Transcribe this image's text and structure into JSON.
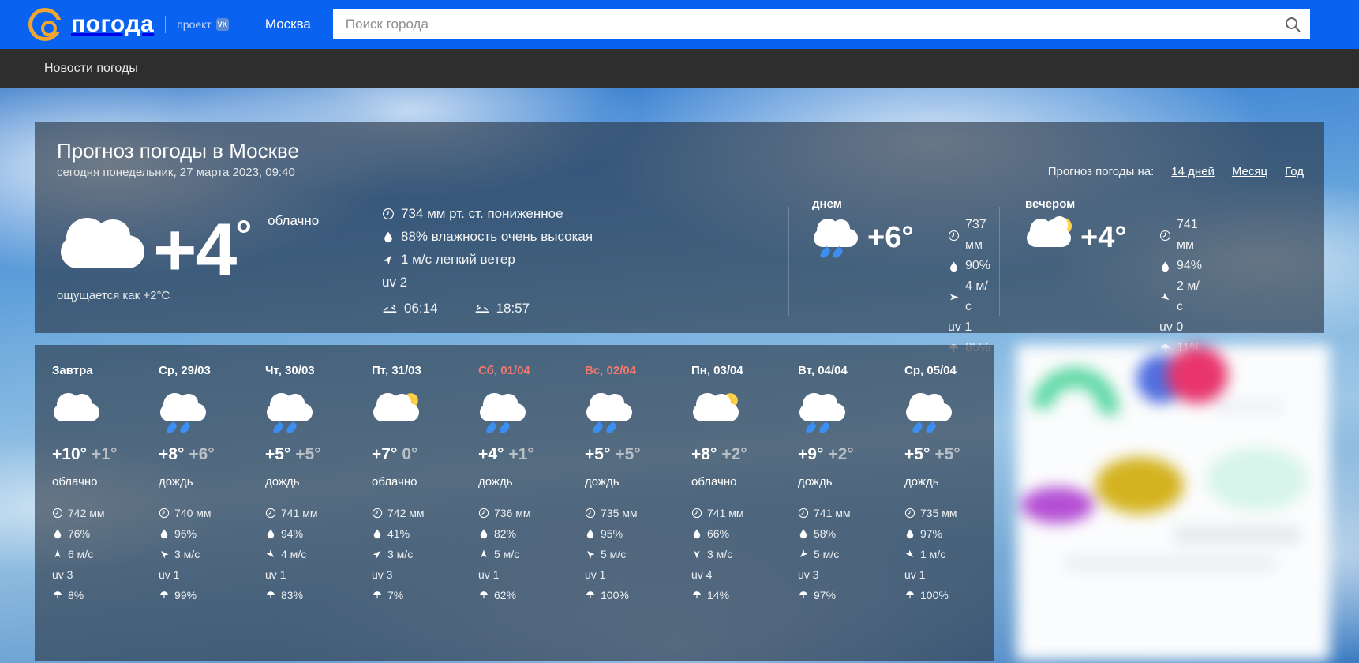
{
  "header": {
    "logo_text": "погода",
    "project_label": "проект",
    "vk_badge": "VK",
    "city_link": "Москва",
    "search_placeholder": "Поиск города",
    "search_value": ""
  },
  "nav": {
    "items": [
      {
        "label": "Новости погоды"
      }
    ]
  },
  "main": {
    "title": "Прогноз погоды в Москве",
    "subtitle": "сегодня понедельник, 27 марта 2023, 09:40",
    "forecast_links_label": "Прогноз погоды на:",
    "forecast_links": [
      {
        "label": "14 дней"
      },
      {
        "label": "Месяц"
      },
      {
        "label": "Год"
      }
    ],
    "current": {
      "icon": "cloud-icon",
      "temp": "+4",
      "degree": "°",
      "description": "облачно",
      "feels_like": "ощущается как +2°C",
      "pressure": "734 мм рт. ст. пониженное",
      "humidity": "88% влажность очень высокая",
      "wind": "1 м/с легкий ветер",
      "uv": "uv 2",
      "sunrise": "06:14",
      "sunset": "18:57"
    },
    "parts": [
      {
        "label": "днем",
        "icon": "cloud-rain-icon",
        "temp": "+6°",
        "pressure": "737 мм",
        "humidity": "90%",
        "wind": "4 м/с",
        "uv": "uv 1",
        "precip": "85%"
      },
      {
        "label": "вечером",
        "icon": "cloud-moon-icon",
        "temp": "+4°",
        "pressure": "741 мм",
        "humidity": "94%",
        "wind": "2 м/с",
        "uv": "uv 0",
        "precip": "11%"
      }
    ]
  },
  "days": [
    {
      "name": "Завтра",
      "weekend": false,
      "icon": "cloud-icon",
      "day_temp": "+10°",
      "night_temp": "+1°",
      "description": "облачно",
      "pressure": "742 мм",
      "humidity": "76%",
      "wind": "6 м/с",
      "wind_dir": "N",
      "uv": "uv 3",
      "precip": "8%"
    },
    {
      "name": "Ср, 29/03",
      "weekend": false,
      "icon": "cloud-rain-icon",
      "day_temp": "+8°",
      "night_temp": "+6°",
      "description": "дождь",
      "pressure": "740 мм",
      "humidity": "96%",
      "wind": "3 м/с",
      "wind_dir": "NW",
      "uv": "uv 1",
      "precip": "99%"
    },
    {
      "name": "Чт, 30/03",
      "weekend": false,
      "icon": "cloud-rain-icon",
      "day_temp": "+5°",
      "night_temp": "+5°",
      "description": "дождь",
      "pressure": "741 мм",
      "humidity": "94%",
      "wind": "4 м/с",
      "wind_dir": "SE",
      "uv": "uv 1",
      "precip": "83%"
    },
    {
      "name": "Пт, 31/03",
      "weekend": false,
      "icon": "cloud-sun-icon",
      "day_temp": "+7°",
      "night_temp": "0°",
      "description": "облачно",
      "pressure": "742 мм",
      "humidity": "41%",
      "wind": "3 м/с",
      "wind_dir": "NE",
      "uv": "uv 3",
      "precip": "7%"
    },
    {
      "name": "Сб, 01/04",
      "weekend": true,
      "icon": "cloud-rain-icon",
      "day_temp": "+4°",
      "night_temp": "+1°",
      "description": "дождь",
      "pressure": "736 мм",
      "humidity": "82%",
      "wind": "5 м/с",
      "wind_dir": "N",
      "uv": "uv 1",
      "precip": "62%"
    },
    {
      "name": "Вс, 02/04",
      "weekend": true,
      "icon": "cloud-rain-icon",
      "day_temp": "+5°",
      "night_temp": "+5°",
      "description": "дождь",
      "pressure": "735 мм",
      "humidity": "95%",
      "wind": "5 м/с",
      "wind_dir": "NW",
      "uv": "uv 1",
      "precip": "100%"
    },
    {
      "name": "Пн, 03/04",
      "weekend": false,
      "icon": "cloud-sun-icon",
      "day_temp": "+8°",
      "night_temp": "+2°",
      "description": "облачно",
      "pressure": "741 мм",
      "humidity": "66%",
      "wind": "3 м/с",
      "wind_dir": "S",
      "uv": "uv 4",
      "precip": "14%"
    },
    {
      "name": "Вт, 04/04",
      "weekend": false,
      "icon": "cloud-rain-icon",
      "day_temp": "+9°",
      "night_temp": "+2°",
      "description": "дождь",
      "pressure": "741 мм",
      "humidity": "58%",
      "wind": "5 м/с",
      "wind_dir": "SW",
      "uv": "uv 3",
      "precip": "97%"
    },
    {
      "name": "Ср, 05/04",
      "weekend": false,
      "icon": "cloud-rain-icon",
      "day_temp": "+5°",
      "night_temp": "+5°",
      "description": "дождь",
      "pressure": "735 мм",
      "humidity": "97%",
      "wind": "1 м/с",
      "wind_dir": "SE",
      "uv": "uv 1",
      "precip": "100%"
    }
  ],
  "colors": {
    "brand_blue": "#0a62f0",
    "nav_dark": "#2e2e2e",
    "panel": "rgba(40,52,66,.62)",
    "weekend_red": "#f2786e",
    "logo_orange": "#f0a530",
    "rain_blue": "#3c8ef0"
  }
}
